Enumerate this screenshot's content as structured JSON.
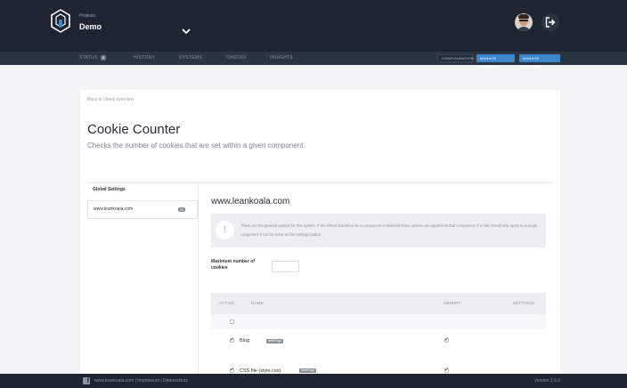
{
  "header": {
    "projects_label": "Projects",
    "project_name": "Demo"
  },
  "nav": {
    "status": "STATUS",
    "status_count": "8",
    "history": "HISTORY",
    "systems": "SYSTEMS",
    "checks": "CHECKS",
    "insights": "INSIGHTS",
    "configuration": "CONFIGURATION",
    "manage_checks": "MANAGE CHECKS",
    "manage_systems": "MANAGE SYSTEMS"
  },
  "page": {
    "back_link": "Back to check overview",
    "title": "Cookie Counter",
    "subtitle": "Checks the number of cookies that are set within a given component."
  },
  "sidebar": {
    "heading": "Global Settings",
    "items": [
      {
        "label": "www.leankoala.com",
        "count": "11"
      }
    ]
  },
  "content": {
    "system_title": "www.leankoala.com",
    "info_text": "These are the general options for this system. If the inherit checkbox for a component is selected those options are applied on that component. If a rule should only apply to a single component it can be done via the settings button.",
    "max_label": "Maximum number of cookies",
    "max_value": ""
  },
  "table": {
    "headers": {
      "active": "ACTIVE",
      "name": "NAME",
      "inherit": "INHERIT",
      "settings": "SETTINGS"
    },
    "rows": [
      {
        "name": "Blog",
        "tag": "WebPage",
        "active": true,
        "inherit": true
      },
      {
        "name": "CSS file (style.css)",
        "tag": "WebPage",
        "active": true,
        "inherit": true
      }
    ]
  },
  "footer": {
    "links": "www.leankoala.com | Impressum | Datenschutz",
    "version": "Version 2.5.0"
  },
  "colors": {
    "topbar": "#1e2530",
    "navbar": "#2b3441",
    "accent_button": "#3d86c9"
  }
}
